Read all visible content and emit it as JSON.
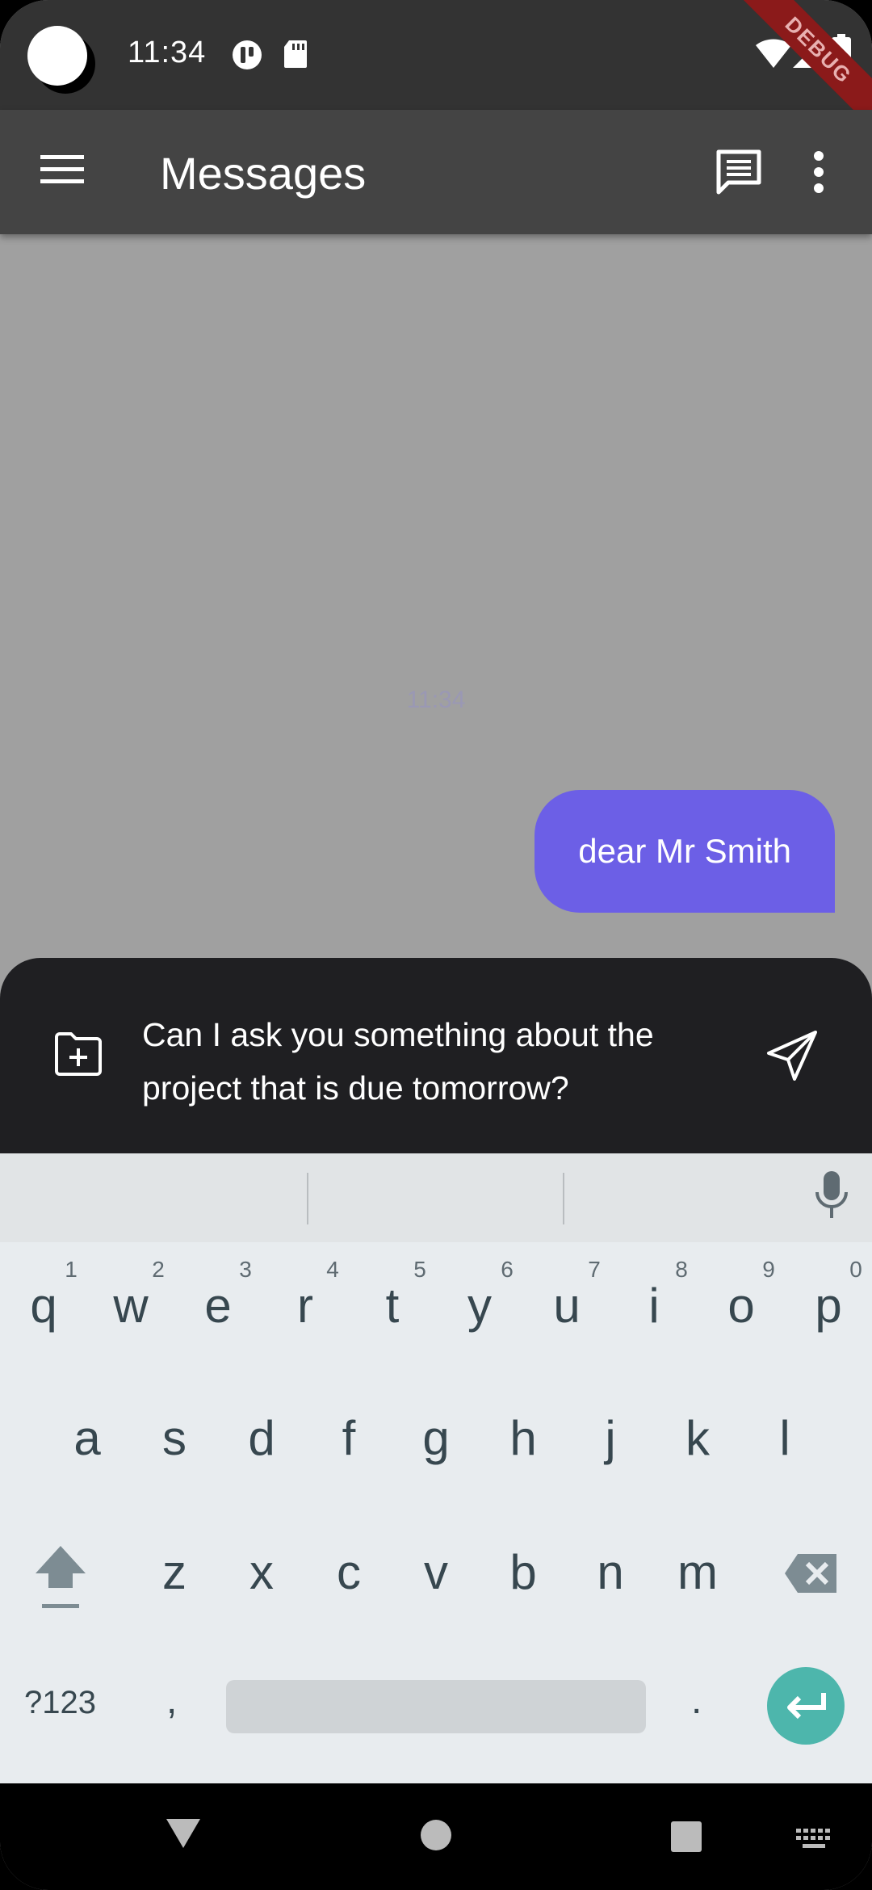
{
  "status_bar": {
    "time": "11:34",
    "debug_label": "DEBUG",
    "icons": [
      "camera-cutout",
      "app-notification-icon",
      "sd-card-icon",
      "wifi-icon",
      "signal-icon",
      "battery-icon"
    ]
  },
  "app_bar": {
    "title": "Messages",
    "icons": [
      "menu-icon",
      "chat-icon",
      "more-vert-icon"
    ]
  },
  "chat": {
    "timestamp": "11:34",
    "messages": [
      {
        "text": "dear Mr Smith",
        "sender": "me"
      }
    ],
    "bubble_color": "#6c5fe6"
  },
  "composer": {
    "text": "Can I ask you something about the project that is due tomorrow?",
    "attach_icon": "add-folder-icon",
    "send_icon": "send-icon"
  },
  "keyboard": {
    "row1": [
      "q",
      "w",
      "e",
      "r",
      "t",
      "y",
      "u",
      "i",
      "o",
      "p"
    ],
    "row1_hints": [
      "1",
      "2",
      "3",
      "4",
      "5",
      "6",
      "7",
      "8",
      "9",
      "0"
    ],
    "row2": [
      "a",
      "s",
      "d",
      "f",
      "g",
      "h",
      "j",
      "k",
      "l"
    ],
    "row3": [
      "z",
      "x",
      "c",
      "v",
      "b",
      "n",
      "m"
    ],
    "symbols_label": "?123",
    "comma": ",",
    "period": ".",
    "enter_color": "#4db6ac"
  }
}
